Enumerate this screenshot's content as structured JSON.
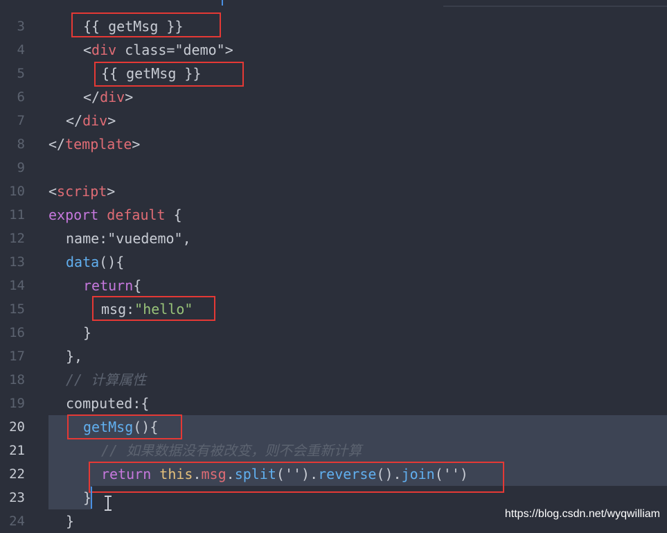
{
  "editor": {
    "lines": [
      {
        "n": "3",
        "segs": [
          {
            "t": "{{ getMsg }}",
            "c": "plain"
          }
        ]
      },
      {
        "n": "4",
        "segs": [
          {
            "t": "<",
            "c": "tag-bracket"
          },
          {
            "t": "div",
            "c": "tag"
          },
          {
            "t": " class",
            "c": "attr"
          },
          {
            "t": "=",
            "c": "punc"
          },
          {
            "t": "\"demo\"",
            "c": "plain"
          },
          {
            "t": ">",
            "c": "tag-bracket"
          }
        ]
      },
      {
        "n": "5",
        "segs": [
          {
            "t": "{{ getMsg }}",
            "c": "plain"
          }
        ]
      },
      {
        "n": "6",
        "segs": [
          {
            "t": "</",
            "c": "tag-bracket"
          },
          {
            "t": "div",
            "c": "tag"
          },
          {
            "t": ">",
            "c": "tag-bracket"
          }
        ]
      },
      {
        "n": "7",
        "segs": [
          {
            "t": "</",
            "c": "tag-bracket"
          },
          {
            "t": "div",
            "c": "tag"
          },
          {
            "t": ">",
            "c": "tag-bracket"
          }
        ]
      },
      {
        "n": "8",
        "segs": [
          {
            "t": "</",
            "c": "tag-bracket"
          },
          {
            "t": "template",
            "c": "tag"
          },
          {
            "t": ">",
            "c": "tag-bracket"
          }
        ]
      },
      {
        "n": "9",
        "segs": []
      },
      {
        "n": "10",
        "segs": [
          {
            "t": "<",
            "c": "tag-bracket"
          },
          {
            "t": "script",
            "c": "tag"
          },
          {
            "t": ">",
            "c": "tag-bracket"
          }
        ]
      },
      {
        "n": "11",
        "segs": [
          {
            "t": "export",
            "c": "kw2"
          },
          {
            "t": " ",
            "c": "plain"
          },
          {
            "t": "default",
            "c": "kw"
          },
          {
            "t": " {",
            "c": "punc"
          }
        ]
      },
      {
        "n": "12",
        "segs": [
          {
            "t": "name",
            "c": "plain"
          },
          {
            "t": ":",
            "c": "punc"
          },
          {
            "t": "\"vuedemo\"",
            "c": "plain"
          },
          {
            "t": ",",
            "c": "punc"
          }
        ]
      },
      {
        "n": "13",
        "segs": [
          {
            "t": "data",
            "c": "fn"
          },
          {
            "t": "(){",
            "c": "punc"
          }
        ]
      },
      {
        "n": "14",
        "segs": [
          {
            "t": "return",
            "c": "kw2"
          },
          {
            "t": "{",
            "c": "punc"
          }
        ]
      },
      {
        "n": "15",
        "segs": [
          {
            "t": "msg",
            "c": "plain"
          },
          {
            "t": ":",
            "c": "punc"
          },
          {
            "t": "\"hello\"",
            "c": "str"
          }
        ]
      },
      {
        "n": "16",
        "segs": [
          {
            "t": "}",
            "c": "punc"
          }
        ]
      },
      {
        "n": "17",
        "segs": [
          {
            "t": "},",
            "c": "punc"
          }
        ]
      },
      {
        "n": "18",
        "segs": [
          {
            "t": "// 计算属性",
            "c": "comment"
          }
        ]
      },
      {
        "n": "19",
        "segs": [
          {
            "t": "computed",
            "c": "plain"
          },
          {
            "t": ":{",
            "c": "punc"
          }
        ]
      },
      {
        "n": "20",
        "segs": [
          {
            "t": "getMsg",
            "c": "fn"
          },
          {
            "t": "(){",
            "c": "punc"
          }
        ]
      },
      {
        "n": "21",
        "segs": [
          {
            "t": "// 如果数据没有被改变，则不会重新计算",
            "c": "comment"
          }
        ]
      },
      {
        "n": "22",
        "segs": [
          {
            "t": "return",
            "c": "kw2"
          },
          {
            "t": " ",
            "c": "plain"
          },
          {
            "t": "this",
            "c": "this"
          },
          {
            "t": ".",
            "c": "punc"
          },
          {
            "t": "msg",
            "c": "prop"
          },
          {
            "t": ".",
            "c": "punc"
          },
          {
            "t": "split",
            "c": "fn"
          },
          {
            "t": "('')",
            "c": "punc"
          },
          {
            "t": ".",
            "c": "punc"
          },
          {
            "t": "reverse",
            "c": "fn"
          },
          {
            "t": "()",
            "c": "punc"
          },
          {
            "t": ".",
            "c": "punc"
          },
          {
            "t": "join",
            "c": "fn"
          },
          {
            "t": "('')",
            "c": "punc"
          }
        ]
      },
      {
        "n": "23",
        "segs": [
          {
            "t": "}",
            "c": "punc"
          }
        ]
      },
      {
        "n": "24",
        "segs": [
          {
            "t": "}",
            "c": "punc"
          }
        ]
      }
    ]
  },
  "watermark": "https://blog.csdn.net/wyqwilliam",
  "colors": {
    "background": "#2b2f3a",
    "selection": "#3d4454",
    "highlight_box": "#e53935",
    "caret": "#4a90e2"
  }
}
